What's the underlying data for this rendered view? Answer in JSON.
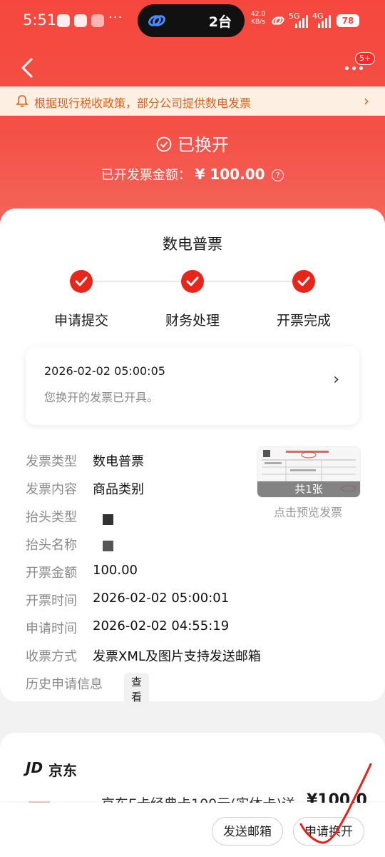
{
  "status_bar": {
    "time": "5:51",
    "more_dots": "···",
    "island_text": "2台",
    "net_speed_value": "42.0",
    "net_speed_unit": "KB/s",
    "signal_1": "5G",
    "signal_2": "4G",
    "battery": "78"
  },
  "nav": {
    "badge": "5+"
  },
  "notice": {
    "text": "根据现行税收政策，部分公司提供数电发票",
    "arrow": "›"
  },
  "status": {
    "title": "已换开",
    "amount_label": "已开发票金额：",
    "amount_value": "¥ 100.00",
    "help": "?"
  },
  "invoice": {
    "type_title": "数电普票",
    "steps": [
      {
        "label": "申请提交",
        "done": true
      },
      {
        "label": "财务处理",
        "done": true
      },
      {
        "label": "开票完成",
        "done": true
      }
    ],
    "progress": {
      "time": "2026-02-02 05:00:05",
      "message": "您换开的发票已开具。",
      "arrow": "›"
    },
    "details": [
      {
        "key": "发票类型",
        "value": "数电普票"
      },
      {
        "key": "发票内容",
        "value": "商品类别"
      },
      {
        "key": "抬头类型",
        "value": ""
      },
      {
        "key": "抬头名称",
        "value": ""
      },
      {
        "key": "开票金额",
        "value": "100.00"
      },
      {
        "key": "开票时间",
        "value": "2026-02-02 05:00:01"
      },
      {
        "key": "申请时间",
        "value": "2026-02-02 04:55:19"
      },
      {
        "key": "收票方式",
        "value": "发票XML及图片支持发送邮箱"
      },
      {
        "key": "历史申请信息",
        "value": ""
      }
    ],
    "view_chip": "查看",
    "preview_count": "共1张",
    "preview_caption": "点击预览发票"
  },
  "shop": {
    "logo": "JD",
    "name": "京东",
    "product_name": "京东E卡经典卡100元(实体卡)送",
    "price": "¥100.0"
  },
  "actions": {
    "send_email": "发送邮箱",
    "reissue": "申请换开"
  },
  "colors": {
    "brand_red": "#f5473d",
    "step_red": "#e8251a",
    "notice_bg": "#fdf0e2",
    "notice_text": "#e2601d"
  }
}
